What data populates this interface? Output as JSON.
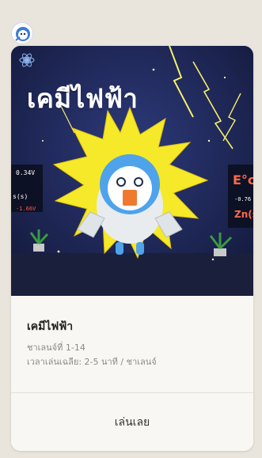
{
  "header": {
    "avatar_icon": "mascot-avatar-icon"
  },
  "banner": {
    "title": "เคมีไฟฟ้า",
    "voltage_label": "0.34V",
    "side_label_left": "s(s)",
    "side_label_left_value": "-1.66V",
    "side_label_right": "E°c",
    "side_label_right_value": "-0.76",
    "side_label_right_species": "Zn(s",
    "background_color": "#1f2a5a",
    "burst_color": "#f5e92a"
  },
  "card": {
    "title": "เคมีไฟฟ้า",
    "stages": "ชาเลนจ์ที่ 1-14",
    "avg_time": "เวลาเล่นเฉลีย: 2-5 นาที / ชาเลนจ์"
  },
  "actions": {
    "play_label": "เล่นเลย"
  }
}
